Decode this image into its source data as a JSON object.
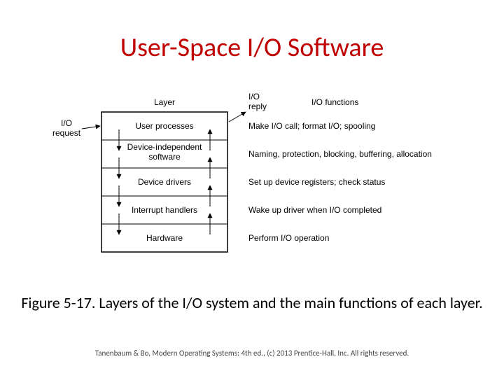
{
  "title": "User-Space I/O Software",
  "headers": {
    "layer": "Layer",
    "ioReply": "I/O\nreply",
    "ioRequest": "I/O\nrequest",
    "ioFunctions": "I/O functions"
  },
  "layers": [
    {
      "name": "User processes",
      "fn": "Make I/O call; format I/O; spooling"
    },
    {
      "name": "Device-independent\nsoftware",
      "fn": "Naming, protection, blocking, buffering, allocation"
    },
    {
      "name": "Device drivers",
      "fn": "Set up device registers; check status"
    },
    {
      "name": "Interrupt handlers",
      "fn": "Wake up driver when I/O completed"
    },
    {
      "name": "Hardware",
      "fn": "Perform I/O operation"
    }
  ],
  "caption": "Figure 5-17. Layers of the I/O system and the main functions of each layer.",
  "copyright": "Tanenbaum & Bo, Modern Operating Systems: 4th ed., (c) 2013 Prentice-Hall, Inc. All rights reserved."
}
